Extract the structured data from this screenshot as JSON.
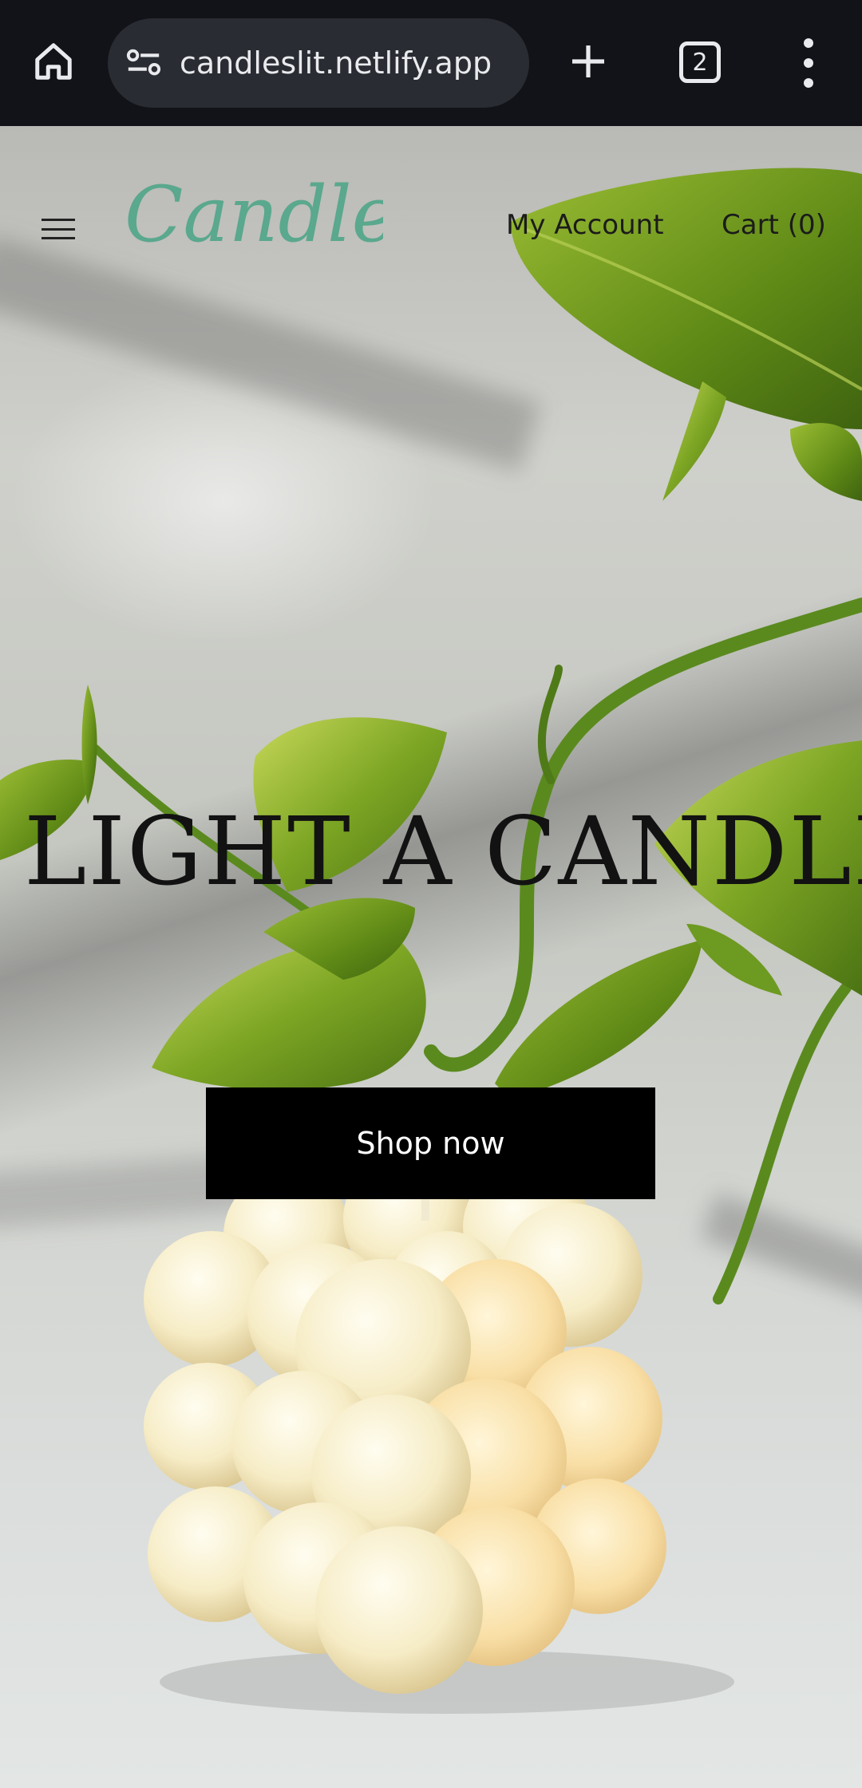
{
  "browser": {
    "url": "candleslit.netlify.app",
    "tab_count": "2"
  },
  "header": {
    "logo_text": "Candlelit",
    "my_account": "My Account",
    "cart": "Cart (0)"
  },
  "hero": {
    "title": "LIGHT A CANDLE",
    "button_label": "Shop now"
  },
  "colors": {
    "logo": "#5aa88e",
    "button_bg": "#000000",
    "button_text": "#ffffff",
    "browser_bar": "#121318"
  },
  "icons": [
    "home-icon",
    "site-info-icon",
    "plus-icon",
    "tab-switcher-icon",
    "more-vert-icon",
    "hamburger-icon"
  ]
}
